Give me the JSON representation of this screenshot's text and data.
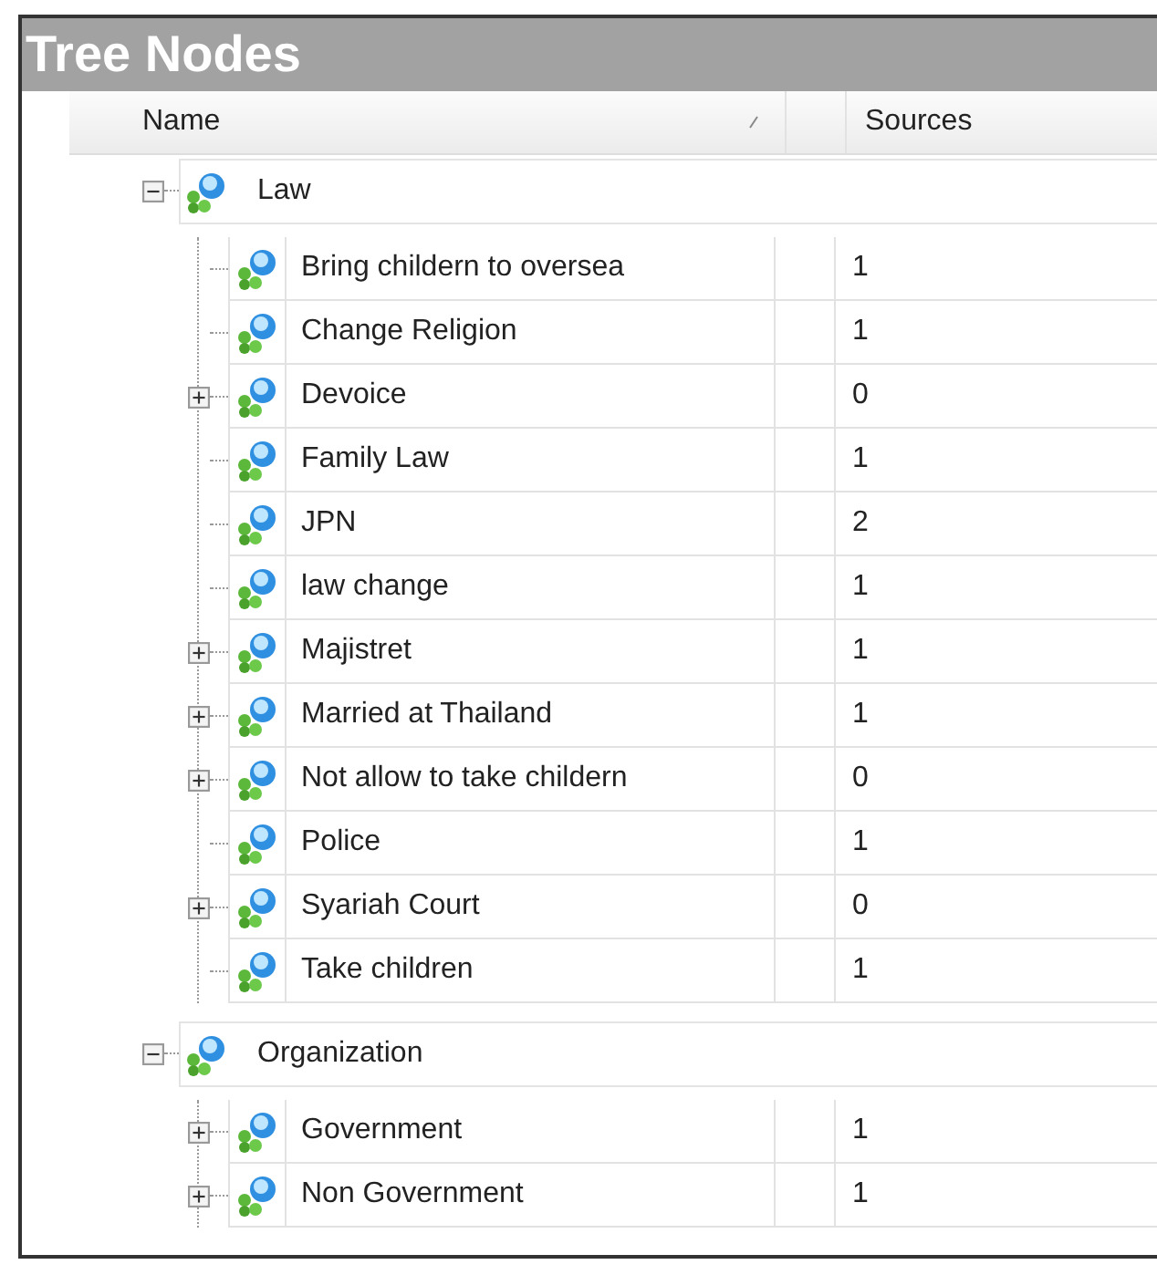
{
  "window": {
    "title": "Tree Nodes"
  },
  "columns": [
    {
      "label": "Name",
      "sorted": true
    },
    {
      "label": "Sources",
      "sorted": false
    }
  ],
  "tree": [
    {
      "name": "Law",
      "expanded": true,
      "children": [
        {
          "name": "Bring childern to oversea",
          "sources": "1",
          "expandable": false
        },
        {
          "name": "Change Religion",
          "sources": "1",
          "expandable": false
        },
        {
          "name": "Devoice",
          "sources": "0",
          "expandable": true
        },
        {
          "name": "Family Law",
          "sources": "1",
          "expandable": false
        },
        {
          "name": "JPN",
          "sources": "2",
          "expandable": false
        },
        {
          "name": "law change",
          "sources": "1",
          "expandable": false
        },
        {
          "name": "Majistret",
          "sources": "1",
          "expandable": true
        },
        {
          "name": "Married at Thailand",
          "sources": "1",
          "expandable": true
        },
        {
          "name": "Not allow to take childern",
          "sources": "0",
          "expandable": true
        },
        {
          "name": "Police",
          "sources": "1",
          "expandable": false
        },
        {
          "name": "Syariah Court",
          "sources": "0",
          "expandable": true
        },
        {
          "name": "Take children",
          "sources": "1",
          "expandable": false
        }
      ]
    },
    {
      "name": "Organization",
      "expanded": true,
      "children": [
        {
          "name": "Government",
          "sources": "1",
          "expandable": true
        },
        {
          "name": "Non Government",
          "sources": "1",
          "expandable": true
        }
      ]
    }
  ]
}
